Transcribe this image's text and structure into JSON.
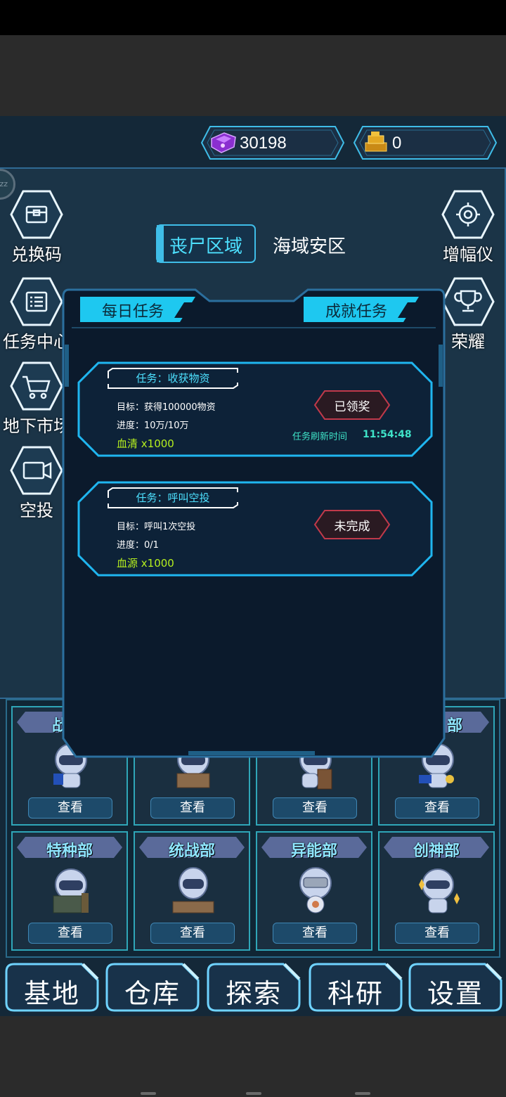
{
  "currency": {
    "gems": "30198",
    "gold": "0",
    "gem_icon": "purple-crystal-icon",
    "gold_icon": "gold-bars-icon"
  },
  "left_menu": [
    {
      "label": "兑换码",
      "icon": "chest-icon"
    },
    {
      "label": "任务中心",
      "icon": "list-icon"
    },
    {
      "label": "地下市场",
      "icon": "cart-icon"
    },
    {
      "label": "空投",
      "icon": "camera-icon"
    }
  ],
  "right_menu": [
    {
      "label": "增幅仪",
      "icon": "target-icon"
    },
    {
      "label": "荣耀",
      "icon": "trophy-icon"
    }
  ],
  "zone_badge": "zz",
  "regions": {
    "active": "丧尸区域",
    "other": "海域安区"
  },
  "modal": {
    "tab_daily": "每日任务",
    "tab_achievement": "成就任务",
    "tasks": [
      {
        "title": "任务：收获物资",
        "goal": "目标：获得100000物资",
        "progress": "进度：10万/10万",
        "reward": "血清 x1000",
        "button": "已领奖",
        "refresh_label": "任务刷新时间",
        "refresh_time": "11:54:48"
      },
      {
        "title": "任务：呼叫空投",
        "goal": "目标：呼叫1次空投",
        "progress": "进度：0/1",
        "reward": "血源 x1000",
        "button": "未完成"
      }
    ]
  },
  "departments": {
    "row1": [
      {
        "name": "战",
        "button": "查看"
      },
      {
        "name": "",
        "button": "查看"
      },
      {
        "name": "",
        "button": "查看"
      },
      {
        "name": "部",
        "button": "查看"
      }
    ],
    "row2": [
      {
        "name": "特种部",
        "button": "查看"
      },
      {
        "name": "统战部",
        "button": "查看"
      },
      {
        "name": "异能部",
        "button": "查看"
      },
      {
        "name": "创神部",
        "button": "查看"
      }
    ]
  },
  "bottom_nav": [
    "基地",
    "仓库",
    "探索",
    "科研",
    "设置"
  ],
  "colors": {
    "accent_cyan": "#4de1ff",
    "reward_green": "#b6f01e",
    "timer_teal": "#3fe3c8",
    "button_red_border": "#c0394a"
  }
}
